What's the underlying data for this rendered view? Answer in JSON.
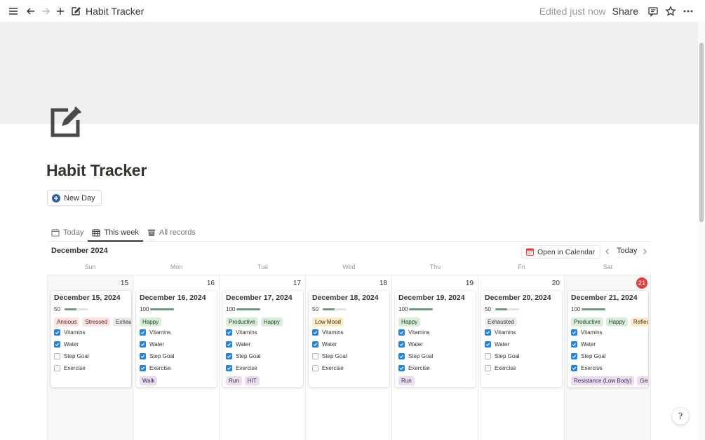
{
  "topbar": {
    "title": "Habit Tracker",
    "edited": "Edited just now",
    "share": "Share"
  },
  "page": {
    "title": "Habit Tracker",
    "new_button": "New Day"
  },
  "tabs": [
    {
      "label": "Today",
      "icon": "calendar-icon"
    },
    {
      "label": "This week",
      "icon": "calendar-grid-icon"
    },
    {
      "label": "All records",
      "icon": "archive-icon"
    }
  ],
  "calendar": {
    "month": "December 2024",
    "open_in_calendar": "Open in Calendar",
    "today_label": "Today",
    "weekdays": [
      "Sun",
      "Mon",
      "Tue",
      "Wed",
      "Thu",
      "Fri",
      "Sat"
    ],
    "days": [
      {
        "num": "15",
        "title": "December 15, 2024",
        "progress": "50",
        "progress_fraction": 0.5,
        "moods": [
          {
            "label": "Anxious",
            "color": "red"
          },
          {
            "label": "Stressed",
            "color": "red"
          },
          {
            "label": "Exhausted",
            "color": "gray"
          }
        ],
        "habits": {
          "vitamins": true,
          "water": true,
          "step_goal": false,
          "exercise": false
        },
        "activities": []
      },
      {
        "num": "16",
        "title": "December 16, 2024",
        "progress": "100",
        "progress_fraction": 1.0,
        "moods": [
          {
            "label": "Happy",
            "color": "green"
          }
        ],
        "habits": {
          "vitamins": true,
          "water": true,
          "step_goal": true,
          "exercise": true
        },
        "activities": [
          {
            "label": "Walk",
            "color": "purple"
          }
        ]
      },
      {
        "num": "17",
        "title": "December 17, 2024",
        "progress": "100",
        "progress_fraction": 1.0,
        "moods": [
          {
            "label": "Productive",
            "color": "green"
          },
          {
            "label": "Happy",
            "color": "green"
          }
        ],
        "habits": {
          "vitamins": true,
          "water": true,
          "step_goal": true,
          "exercise": true
        },
        "activities": [
          {
            "label": "Run",
            "color": "purple"
          },
          {
            "label": "HIT",
            "color": "purple"
          }
        ]
      },
      {
        "num": "18",
        "title": "December 18, 2024",
        "progress": "50",
        "progress_fraction": 0.5,
        "moods": [
          {
            "label": "Low Mood",
            "color": "orange"
          }
        ],
        "habits": {
          "vitamins": true,
          "water": true,
          "step_goal": false,
          "exercise": false
        },
        "activities": []
      },
      {
        "num": "19",
        "title": "December 19, 2024",
        "progress": "100",
        "progress_fraction": 1.0,
        "moods": [
          {
            "label": "Happy",
            "color": "green"
          }
        ],
        "habits": {
          "vitamins": true,
          "water": true,
          "step_goal": true,
          "exercise": true
        },
        "activities": [
          {
            "label": "Run",
            "color": "purple"
          }
        ]
      },
      {
        "num": "20",
        "title": "December 20, 2024",
        "progress": "50",
        "progress_fraction": 0.5,
        "moods": [
          {
            "label": "Exhausted",
            "color": "gray"
          }
        ],
        "habits": {
          "vitamins": true,
          "water": true,
          "step_goal": false,
          "exercise": false
        },
        "activities": []
      },
      {
        "num": "21",
        "title": "December 21, 2024",
        "progress": "100",
        "progress_fraction": 1.0,
        "is_today": true,
        "moods": [
          {
            "label": "Productive",
            "color": "green"
          },
          {
            "label": "Happy",
            "color": "green"
          },
          {
            "label": "Reflective",
            "color": "orange"
          }
        ],
        "habits": {
          "vitamins": true,
          "water": true,
          "step_goal": true,
          "exercise": true
        },
        "activities": [
          {
            "label": "Resistance (Low Body)",
            "color": "purple"
          },
          {
            "label": "General",
            "color": "purple"
          }
        ]
      }
    ],
    "habit_labels": {
      "vitamins": "Vitamins",
      "water": "Water",
      "step_goal": "Step Goal",
      "exercise": "Exercise"
    }
  },
  "help_label": "?"
}
